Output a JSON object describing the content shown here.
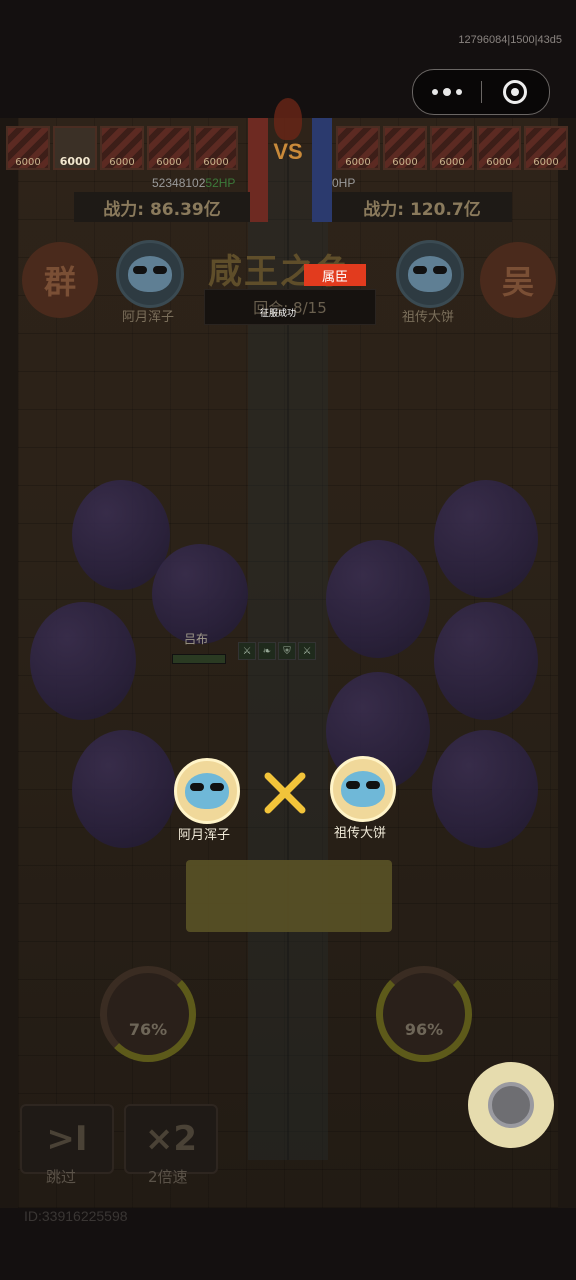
{
  "system": {
    "build_info": "12796084|1500|43d5"
  },
  "battle": {
    "vs_label": "VS",
    "left": {
      "hp_slots": [
        "6000",
        "6000",
        "6000",
        "6000",
        "6000"
      ],
      "hp_prefix": "52348102",
      "hp_highlight": "52HP",
      "power": "战力: 86.39亿",
      "faction": "群",
      "player_name": "阿月浑子"
    },
    "right": {
      "hp_slots": [
        "6000",
        "6000",
        "6000",
        "6000",
        "6000"
      ],
      "hp_text": "0HP",
      "power": "战力: 120.7亿",
      "faction": "吴",
      "player_name": "祖传大饼"
    },
    "title": "咸王之争",
    "rank_badge": "属臣",
    "round_label": "回合: 8/15",
    "toast": "征服成功",
    "unit_name": "吕布",
    "buff_icons": [
      "sword-buff-icon",
      "leaf-buff-icon",
      "shield-buff-icon",
      "sword-debuff-icon"
    ],
    "commander_left": "阿月浑子",
    "commander_right": "祖传大饼",
    "skill_left_percent": "76%",
    "skill_right_percent": "96%"
  },
  "controls": {
    "skip_label": "跳过",
    "skip_icon": ">I",
    "speed_label": "2倍速",
    "speed_icon": "×2"
  },
  "footer": {
    "player_id": "ID:33916225598"
  },
  "colors": {
    "rank_badge": "#e23b1e",
    "commander_ring": "#fff4c8",
    "float_button": "#e6dcae"
  }
}
